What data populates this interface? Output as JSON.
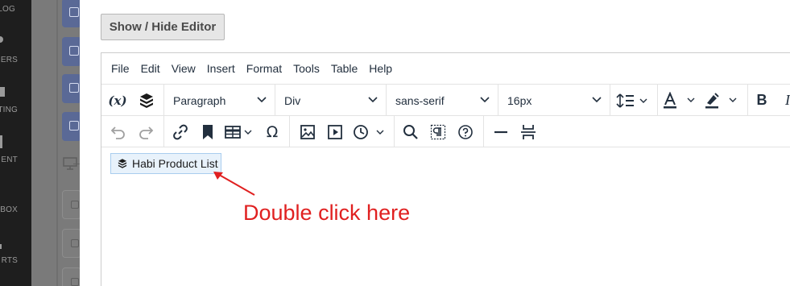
{
  "sidebar": {
    "items": [
      {
        "label": "LOG",
        "icon": "log-icon"
      },
      {
        "label": "MERS",
        "icon": "customers-icon"
      },
      {
        "label": "TING",
        "icon": "marketing-icon"
      },
      {
        "label": "ENT",
        "icon": "content-icon"
      },
      {
        "label": "YBOX",
        "icon": "toybox-icon"
      },
      {
        "label": "RTS",
        "icon": "reports-icon"
      }
    ]
  },
  "toggle_button": {
    "label": "Show / Hide Editor"
  },
  "editor": {
    "menu": [
      "File",
      "Edit",
      "View",
      "Insert",
      "Format",
      "Tools",
      "Table",
      "Help"
    ],
    "toolbar1": {
      "variable_icon_text": "(x)",
      "block_format": "Paragraph",
      "container": "Div",
      "font_family": "sans-serif",
      "font_size": "16px",
      "bold_label": "B",
      "italic_label": "I"
    },
    "content": {
      "widget_label": "Habi Product List"
    }
  },
  "annotation": {
    "text": "Double click here",
    "color": "#e02020"
  },
  "colors": {
    "accent_tile": "#5a6996",
    "widget_bg": "#e8f2fb",
    "widget_border": "#a9cdee"
  }
}
